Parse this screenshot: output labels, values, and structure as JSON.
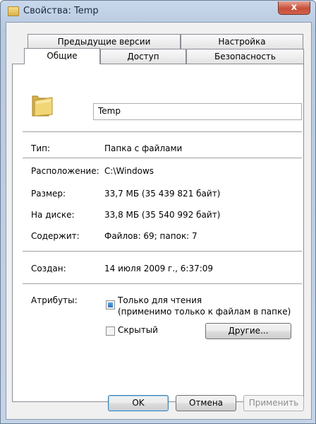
{
  "window": {
    "title": "Свойства: Temp",
    "close_glyph": "x"
  },
  "tabs": {
    "row_back": [
      "Предыдущие версии",
      "Настройка"
    ],
    "row_front": [
      "Общие",
      "Доступ",
      "Безопасность"
    ]
  },
  "general": {
    "name_value": "Temp",
    "type_label": "Тип:",
    "type_value": "Папка с файлами",
    "location_label": "Расположение:",
    "location_value": "C:\\Windows",
    "size_label": "Размер:",
    "size_value": "33,7 МБ (35 439 821 байт)",
    "ondisk_label": "На диске:",
    "ondisk_value": "33,8 МБ (35 540 992 байт)",
    "contains_label": "Содержит:",
    "contains_value": "Файлов: 69; папок: 7",
    "created_label": "Создан:",
    "created_value": "14 июля 2009 г., 6:37:09",
    "attributes_label": "Атрибуты:",
    "readonly_label": "Только для чтения",
    "readonly_note": "(применимо только к файлам в папке)",
    "hidden_label": "Скрытый",
    "other_button": "Другие..."
  },
  "footer": {
    "ok": "OK",
    "cancel": "Отмена",
    "apply": "Применить"
  }
}
